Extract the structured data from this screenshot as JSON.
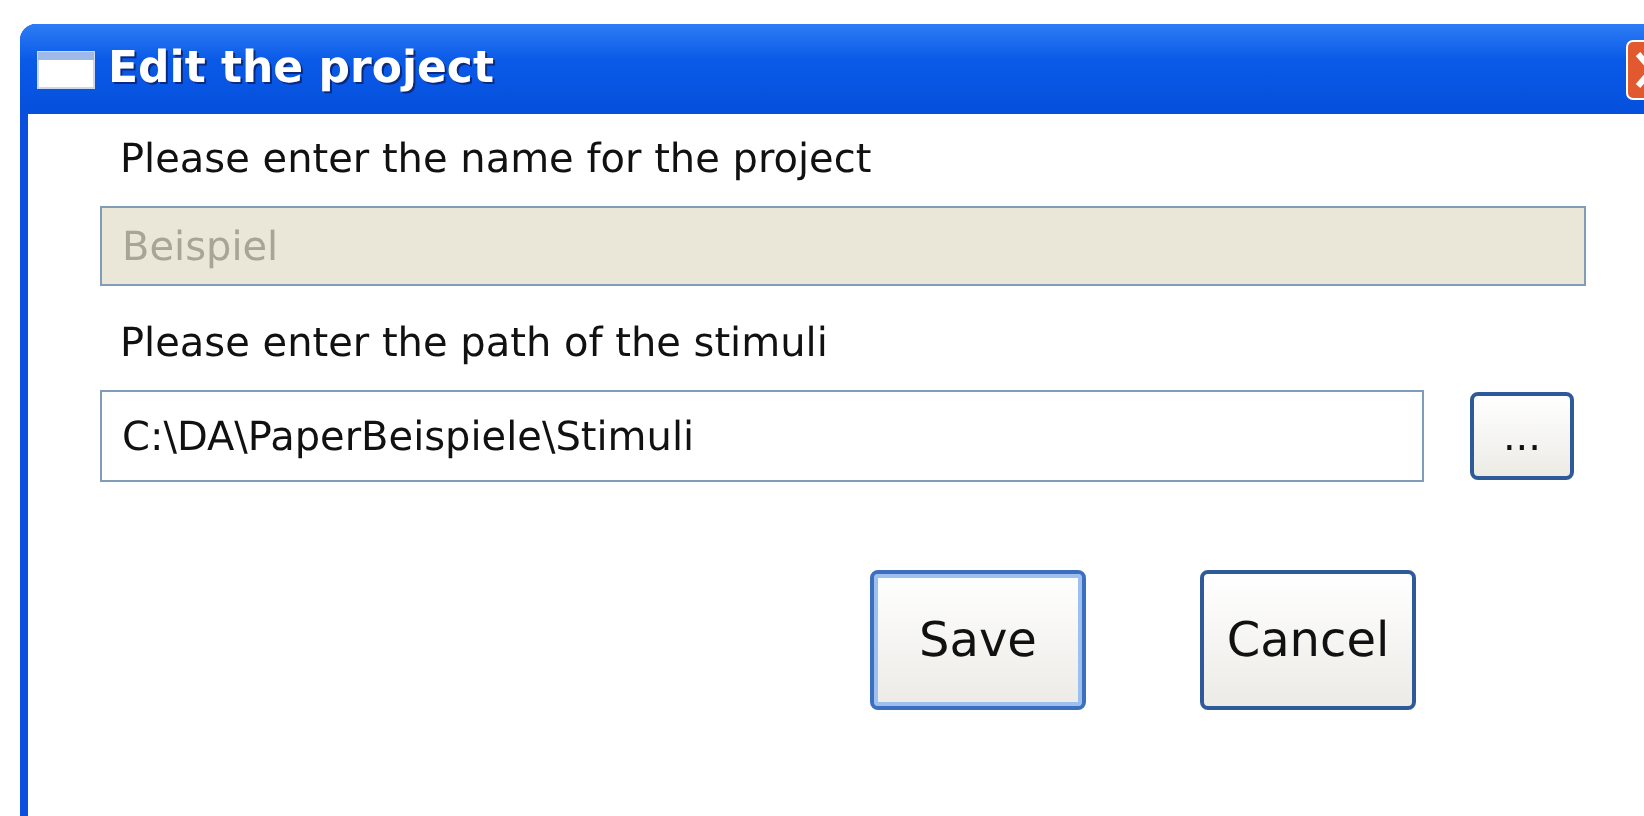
{
  "window": {
    "title": "Edit the project"
  },
  "name_label": "Please enter the name for the project",
  "name_field": {
    "value": "Beispiel",
    "disabled": true
  },
  "path_label": "Please enter the path of the stimuli",
  "path_field": {
    "value": "C:\\DA\\PaperBeispiele\\Stimuli",
    "disabled": false
  },
  "browse_button": "...",
  "buttons": [
    {
      "label": "Save",
      "default": true
    },
    {
      "label": "Cancel",
      "default": false
    }
  ]
}
